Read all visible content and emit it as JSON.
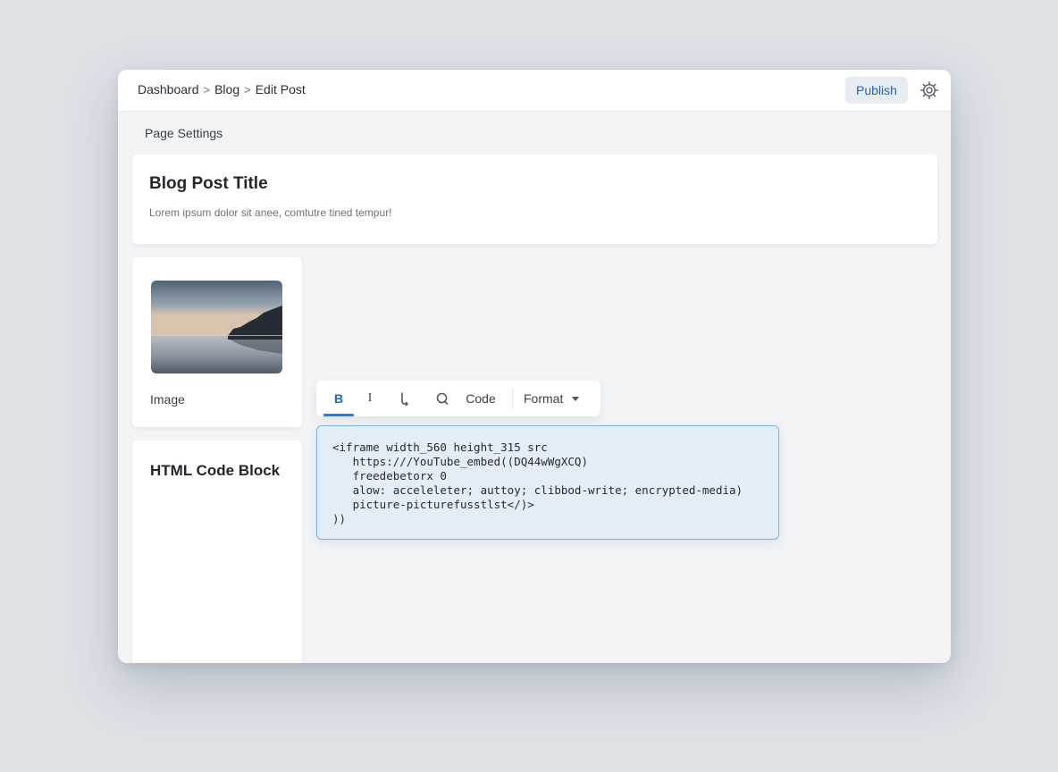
{
  "breadcrumb": {
    "items": [
      "Dashboard",
      "Blog",
      "Edit Post"
    ],
    "separator": ">"
  },
  "header": {
    "publish_label": "Publish",
    "settings_icon": "gear-icon"
  },
  "section_label": "Page Settings",
  "post": {
    "title": "Blog Post Title",
    "excerpt": "Lorem ipsum dolor sit anee, comtutre tined tempur!"
  },
  "image_card": {
    "label": "Image"
  },
  "code_card": {
    "title": "HTML Code Block"
  },
  "toolbar": {
    "bold_label": "B",
    "italic_label": "I",
    "link_label": "L",
    "quote_label": "Q",
    "code_label": "Code",
    "format_label": "Format",
    "active": "bold"
  },
  "code_editor": {
    "lines": [
      "<iframe width_560 height_315 src",
      "   https:///YouTube_embed((DQ44wWgXCQ)",
      "   freedebetorx 0",
      "   alow: acceleleter; auttoy; clibbod-write; encrypted-media)",
      "   picture-picturefusstlst</)>",
      "))"
    ]
  },
  "colors": {
    "accent": "#2366b3",
    "active_underline": "#2a7de0",
    "editor_background": "#e3edf8",
    "editor_border": "#79b2ea"
  }
}
